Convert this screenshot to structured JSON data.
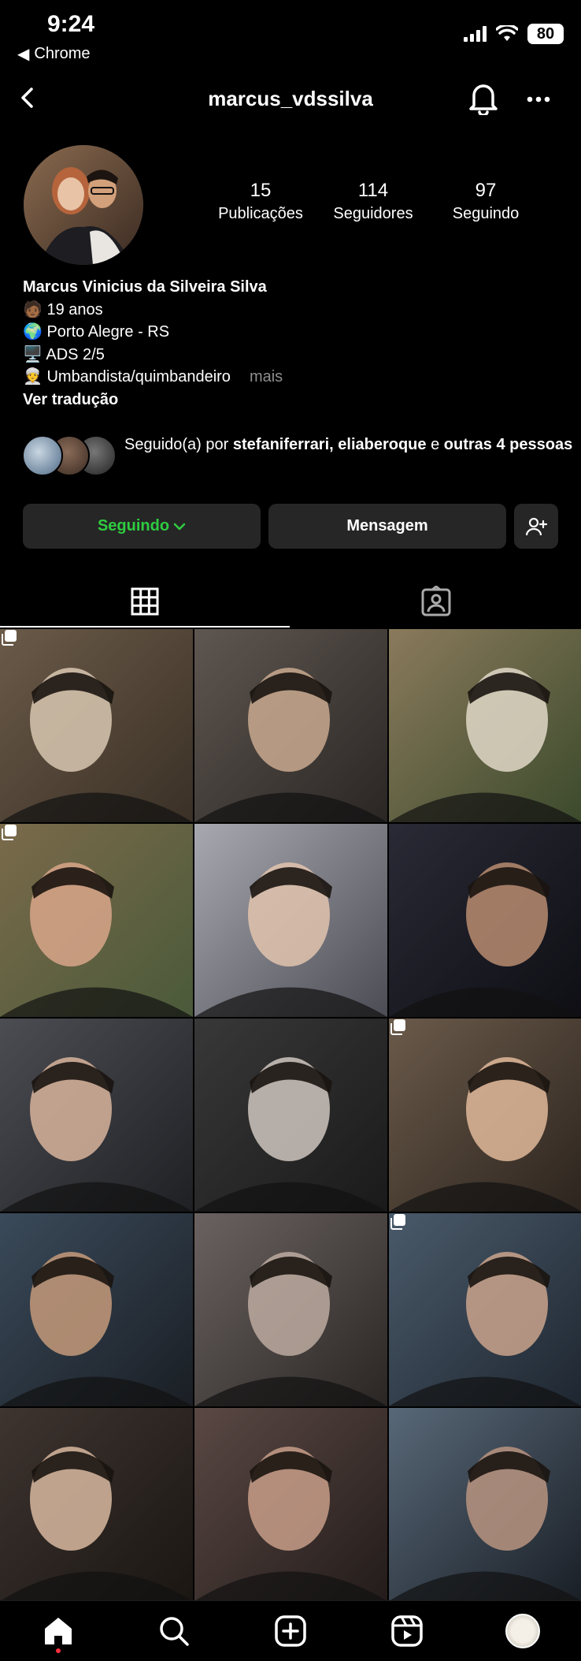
{
  "status_bar": {
    "time": "9:24",
    "back_app": "Chrome",
    "battery": "80"
  },
  "header": {
    "username": "marcus_vdssilva"
  },
  "stats": [
    {
      "value": "15",
      "label": "Publicações"
    },
    {
      "value": "114",
      "label": "Seguidores"
    },
    {
      "value": "97",
      "label": "Seguindo"
    }
  ],
  "bio": {
    "name": "Marcus Vinicius da Silveira Silva",
    "lines": [
      "🧑🏾 19 anos",
      "🌍 Porto Alegre - RS",
      "🖥️ ADS 2/5",
      "👳 Umbandista/quimbandeiro"
    ],
    "more": "mais",
    "translate": "Ver tradução"
  },
  "followed_by": {
    "prefix": "Seguido(a) por ",
    "users": "stefaniferrari, eliaberoque",
    "middle": " e ",
    "rest": "outras 4 pessoas"
  },
  "buttons": {
    "following": "Seguindo",
    "message": "Mensagem"
  },
  "icons": {
    "back": "chevron-left-icon",
    "bell": "bell-icon",
    "more": "more-horizontal-icon",
    "add_user": "add-user-icon",
    "grid": "grid-icon",
    "tagged": "tagged-icon",
    "multi": "carousel-icon"
  },
  "colors": {
    "following": "#2ecc40",
    "background": "#000000",
    "button_bg": "#262626",
    "muted": "#8e8e8e"
  },
  "posts": [
    {
      "multi": true
    },
    {
      "multi": false
    },
    {
      "multi": false
    },
    {
      "multi": true
    },
    {
      "multi": false
    },
    {
      "multi": false
    },
    {
      "multi": false
    },
    {
      "multi": false
    },
    {
      "multi": true
    },
    {
      "multi": false
    },
    {
      "multi": false
    },
    {
      "multi": true
    },
    {
      "multi": false
    },
    {
      "multi": false
    },
    {
      "multi": false
    }
  ],
  "bottom_nav": [
    "home-icon",
    "search-icon",
    "create-icon",
    "reels-icon",
    "profile-icon"
  ]
}
